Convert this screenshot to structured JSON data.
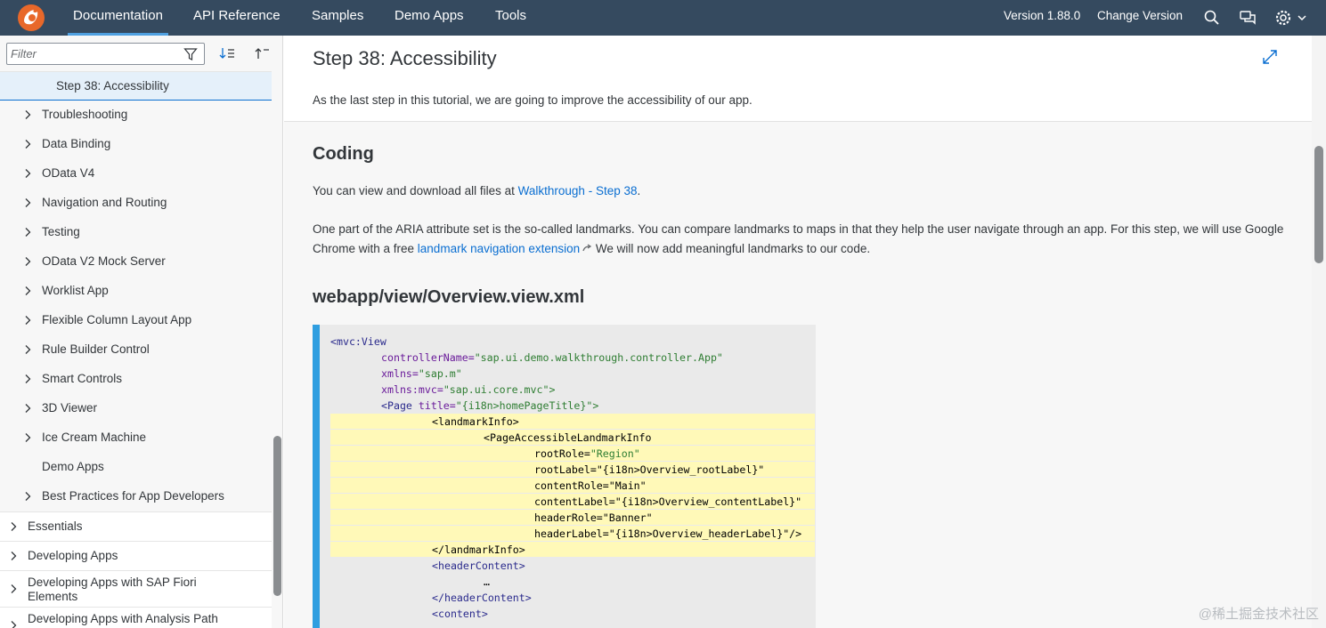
{
  "shell": {
    "nav": [
      "Documentation",
      "API Reference",
      "Samples",
      "Demo Apps",
      "Tools"
    ],
    "version": "Version 1.88.0",
    "change_version": "Change Version"
  },
  "sidebar": {
    "filter_placeholder": "Filter",
    "selected": "Step 38: Accessibility",
    "items": [
      "Troubleshooting",
      "Data Binding",
      "OData V4",
      "Navigation and Routing",
      "Testing",
      "OData V2 Mock Server",
      "Worklist App",
      "Flexible Column Layout App",
      "Rule Builder Control",
      "Smart Controls",
      "3D Viewer",
      "Ice Cream Machine",
      "Demo Apps",
      "Best Practices for App Developers"
    ],
    "top_items": [
      "Essentials",
      "Developing Apps",
      "Developing Apps with SAP Fiori Elements",
      "Developing Apps with Analysis Path"
    ]
  },
  "main": {
    "title": "Step 38: Accessibility",
    "intro": "As the last step in this tutorial, we are going to improve the accessibility of our app.",
    "coding_heading": "Coding",
    "p1_before": "You can view and download all files at ",
    "p1_link": "Walkthrough - Step 38",
    "p1_after": ".",
    "p2_before": "One part of the ARIA attribute set is the so-called landmarks. You can compare landmarks to maps in that they help the user navigate through an app. For this step, we will use Google Chrome with a free ",
    "p2_link": "landmark navigation extension",
    "p2_after": "  We will now add meaningful landmarks to our code.",
    "file_heading": "webapp/view/Overview.view.xml"
  },
  "code": {
    "l1": "<mvc:View",
    "l2a": "controllerName=",
    "l2b": "\"sap.ui.demo.walkthrough.controller.App\"",
    "l3a": "xmlns=",
    "l3b": "\"sap.m\"",
    "l4a": "xmlns:mvc=",
    "l4b": "\"sap.ui.core.mvc\">",
    "l5a": "<Page ",
    "l5b": "title=",
    "l5c": "\"{i18n>homePageTitle}\">",
    "l6": "<landmarkInfo>",
    "l7": "<PageAccessibleLandmarkInfo",
    "l8a": "rootRole=",
    "l8b": "\"Region\"",
    "l9a": "rootLabel=",
    "l9b": "\"{i18n>Overview_rootLabel}\"",
    "l10": "contentRole=\"Main\"",
    "l11": "contentLabel=\"{i18n>Overview_contentLabel}\"",
    "l12": "headerRole=\"Banner\"",
    "l13": "headerLabel=\"{i18n>Overview_headerLabel}\"/>",
    "l14": "</landmarkInfo>",
    "l15": "<headerContent>",
    "l16": "…",
    "l17": "</headerContent>",
    "l18": "<content>"
  },
  "watermark": "@稀土掘金技术社区"
}
